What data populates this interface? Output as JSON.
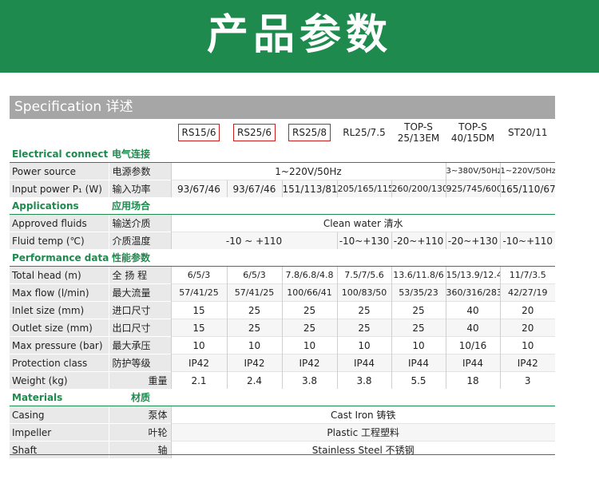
{
  "banner": {
    "title": "产品参数"
  },
  "spec_header": {
    "title": "Specification  详述"
  },
  "models": [
    {
      "label": "RS15/6",
      "boxed": true
    },
    {
      "label": "RS25/6",
      "boxed": true
    },
    {
      "label": "RS25/8",
      "boxed": true
    },
    {
      "label": "RL25/7.5",
      "boxed": false
    },
    {
      "label": "TOP-S 25/13EM",
      "boxed": false
    },
    {
      "label": "TOP-S 40/15DM",
      "boxed": false
    },
    {
      "label": "ST20/11",
      "boxed": false
    }
  ],
  "sections": {
    "electrical": {
      "en": "Electrical connection",
      "cn": "电气连接"
    },
    "applications": {
      "en": "Applications",
      "cn": "应用场合"
    },
    "performance": {
      "en": "Performance data",
      "cn": "性能参数"
    },
    "materials": {
      "en": "Materials",
      "cn": "材质"
    }
  },
  "rows": {
    "power_source": {
      "en": "Power source",
      "cn": "电源参数",
      "v1": "1~220V/50Hz",
      "v2": "3~380V/50Hz",
      "v3": "1~220V/50Hz"
    },
    "input_power": {
      "en": "Input power P₁ (W)",
      "cn": "输入功率",
      "values": [
        "93/67/46",
        "93/67/46",
        "151/113/81",
        "205/165/115",
        "260/200/130",
        "925/745/600",
        "165/110/67"
      ]
    },
    "approved_fluids": {
      "en": "Approved fluids",
      "cn": "输送介质",
      "value": "Clean water  清水"
    },
    "fluid_temp": {
      "en": "Fluid temp (℃)",
      "cn": "介质温度",
      "v1": "-10 ~ +110",
      "v2": "-10~+130",
      "v3": "-20~+110",
      "v4": "-20~+130",
      "v5": "-10~+110"
    },
    "total_head": {
      "en": "Total head (m)",
      "cn": "全 扬 程",
      "values": [
        "6/5/3",
        "6/5/3",
        "7.8/6.8/4.8",
        "7.5/7/5.6",
        "13.6/11.8/6",
        "15/13.9/12.4",
        "11/7/3.5"
      ]
    },
    "max_flow": {
      "en": "Max flow (l/min)",
      "cn": "最大流量",
      "values": [
        "57/41/25",
        "57/41/25",
        "100/66/41",
        "100/83/50",
        "53/35/23",
        "360/316/283",
        "42/27/19"
      ]
    },
    "inlet_size": {
      "en": "Inlet size (mm)",
      "cn": "进口尺寸",
      "values": [
        "15",
        "25",
        "25",
        "25",
        "25",
        "40",
        "20"
      ]
    },
    "outlet_size": {
      "en": "Outlet size (mm)",
      "cn": "出口尺寸",
      "values": [
        "15",
        "25",
        "25",
        "25",
        "25",
        "40",
        "20"
      ]
    },
    "max_pressure": {
      "en": "Max pressure (bar)",
      "cn": "最大承压",
      "values": [
        "10",
        "10",
        "10",
        "10",
        "10",
        "10/16",
        "10"
      ]
    },
    "protection": {
      "en": "Protection class",
      "cn": "防护等级",
      "values": [
        "IP42",
        "IP42",
        "IP42",
        "IP44",
        "IP44",
        "IP44",
        "IP42"
      ]
    },
    "weight": {
      "en": "Weight  (kg)",
      "cn": "重量",
      "values": [
        "2.1",
        "2.4",
        "3.8",
        "3.8",
        "5.5",
        "18",
        "3"
      ]
    },
    "casing": {
      "en": "Casing",
      "cn": "泵体",
      "value": "Cast Iron  铸铁"
    },
    "impeller": {
      "en": "Impeller",
      "cn": "叶轮",
      "value": "Plastic  工程塑料"
    },
    "shaft": {
      "en": "Shaft",
      "cn": "轴",
      "value": "Stainless Steel  不锈钢"
    }
  },
  "colors": {
    "brand_green": "#1e8a4e",
    "header_gray": "#a6a6a6",
    "model_box_red": "#cc2020"
  }
}
